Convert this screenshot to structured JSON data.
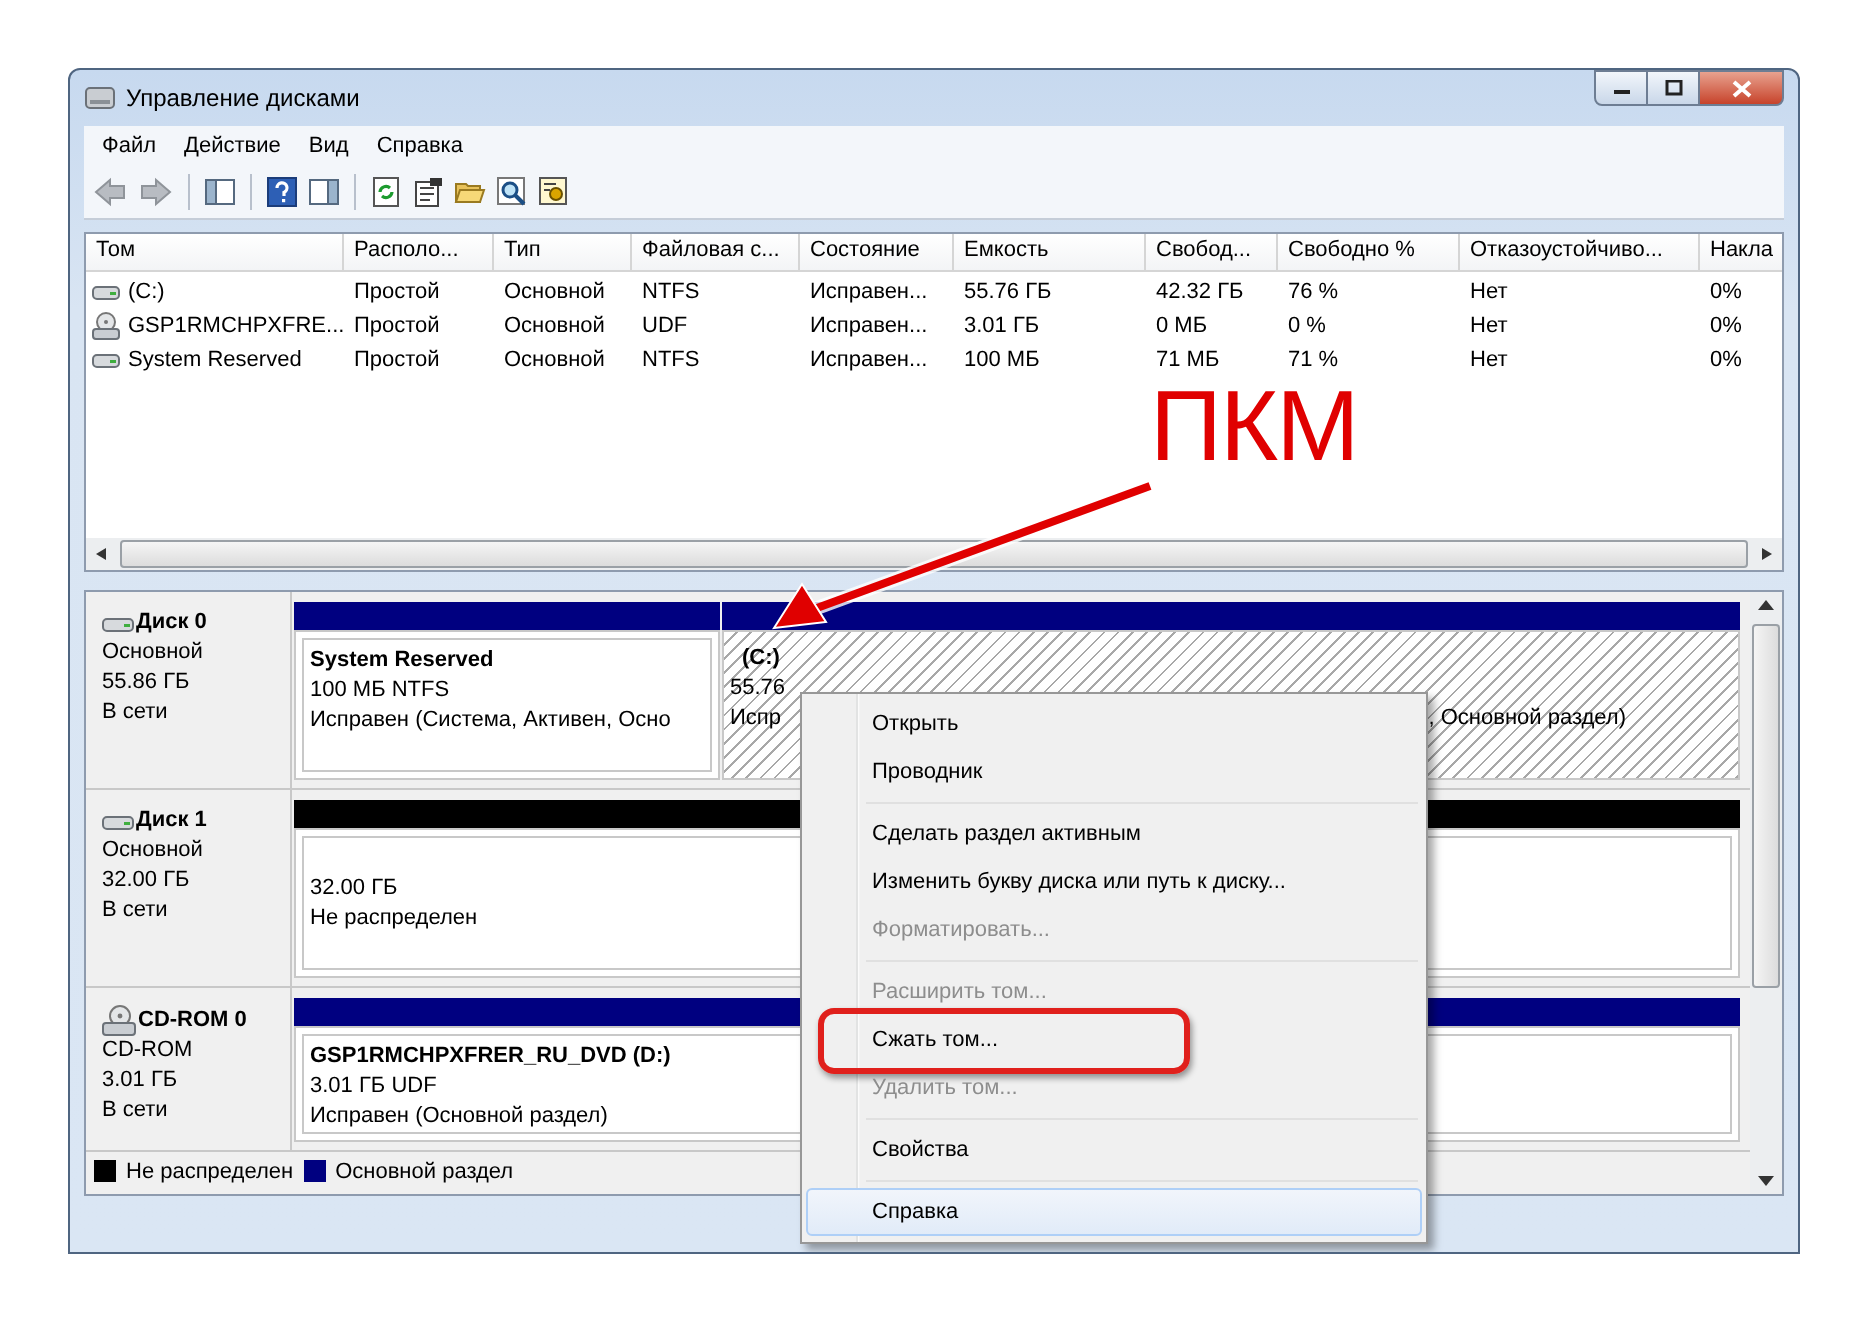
{
  "window": {
    "title": "Управление дисками"
  },
  "menu": [
    "Файл",
    "Действие",
    "Вид",
    "Справка"
  ],
  "volumes": {
    "columns": [
      "Том",
      "Располо...",
      "Тип",
      "Файловая с...",
      "Состояние",
      "Емкость",
      "Свобод...",
      "Свободно %",
      "Отказоустойчиво...",
      "Накла"
    ],
    "rows": [
      {
        "kind": "drive",
        "cells": [
          "(C:)",
          "Простой",
          "Основной",
          "NTFS",
          "Исправен...",
          "55.76 ГБ",
          "42.32 ГБ",
          "76 %",
          "Нет",
          "0%"
        ]
      },
      {
        "kind": "cdrom",
        "cells": [
          "GSP1RMCHPXFRE...",
          "Простой",
          "Основной",
          "UDF",
          "Исправен...",
          "3.01 ГБ",
          "0 МБ",
          "0 %",
          "Нет",
          "0%"
        ]
      },
      {
        "kind": "drive",
        "cells": [
          "System Reserved",
          "Простой",
          "Основной",
          "NTFS",
          "Исправен...",
          "100 МБ",
          "71 МБ",
          "71 %",
          "Нет",
          "0%"
        ]
      }
    ]
  },
  "disks": [
    {
      "kind": "drive",
      "name": "Диск 0",
      "type": "Основной",
      "size": "55.86 ГБ",
      "status": "В сети",
      "partitions": [
        {
          "kind": "primary",
          "selected": false,
          "title": "System Reserved",
          "size": "100 МБ NTFS",
          "status": "Исправен (Система, Активен, Осно"
        },
        {
          "kind": "primary",
          "selected": true,
          "title": "(C:)",
          "size": "55.76",
          "status": "Испр",
          "status_tail": ", Основной раздел)"
        }
      ]
    },
    {
      "kind": "drive",
      "name": "Диск 1",
      "type": "Основной",
      "size": "32.00 ГБ",
      "status": "В сети",
      "partitions": [
        {
          "kind": "unallocated",
          "selected": false,
          "size": "32.00 ГБ",
          "status": "Не распределен"
        }
      ]
    },
    {
      "kind": "cdrom",
      "name": "CD-ROM 0",
      "type": "CD-ROM",
      "size": "3.01 ГБ",
      "status": "В сети",
      "partitions": [
        {
          "kind": "primary",
          "selected": false,
          "title": "GSP1RMCHPXFRER_RU_DVD  (D:)",
          "size": "3.01 ГБ UDF",
          "status": "Исправен (Основной раздел)"
        }
      ]
    }
  ],
  "legend": [
    {
      "label": "Не распределен",
      "color": "#000000"
    },
    {
      "label": "Основной раздел",
      "color": "#000080"
    }
  ],
  "context_menu": {
    "groups": [
      [
        {
          "label": "Открыть",
          "disabled": false,
          "selected": false,
          "circled": false
        },
        {
          "label": "Проводник",
          "disabled": false,
          "selected": false,
          "circled": false
        }
      ],
      [
        {
          "label": "Сделать раздел активным",
          "disabled": false,
          "selected": false,
          "circled": false
        },
        {
          "label": "Изменить букву диска или путь к диску...",
          "disabled": false,
          "selected": false,
          "circled": false
        },
        {
          "label": "Форматировать...",
          "disabled": true,
          "selected": false,
          "circled": false
        }
      ],
      [
        {
          "label": "Расширить том...",
          "disabled": true,
          "selected": false,
          "circled": false
        },
        {
          "label": "Сжать том...",
          "disabled": false,
          "selected": false,
          "circled": true
        },
        {
          "label": "Удалить том...",
          "disabled": true,
          "selected": false,
          "circled": false
        }
      ],
      [
        {
          "label": "Свойства",
          "disabled": false,
          "selected": false,
          "circled": false
        }
      ],
      [
        {
          "label": "Справка",
          "disabled": false,
          "selected": true,
          "circled": false
        }
      ]
    ]
  },
  "annotation": {
    "label": "ПКМ"
  }
}
